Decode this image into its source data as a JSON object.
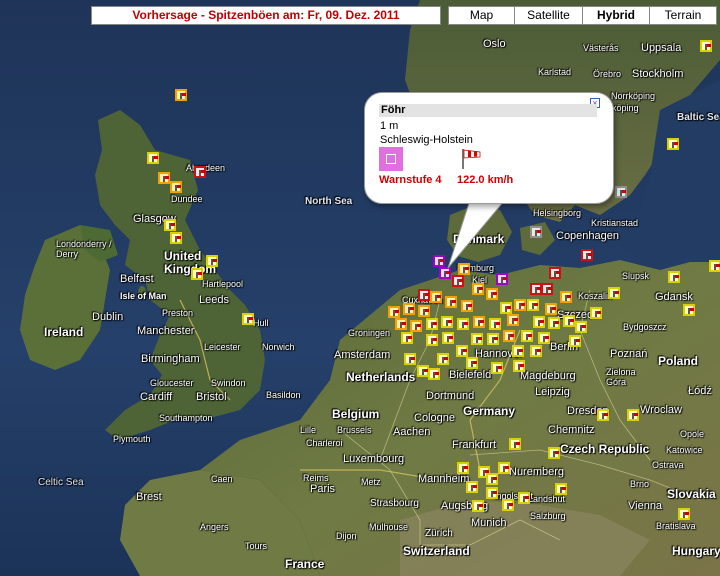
{
  "header": {
    "forecast_title": "Vorhersage - Spitzenböen am: Fr, 09. Dez. 2011"
  },
  "map_types": [
    {
      "label": "Map",
      "active": false
    },
    {
      "label": "Satellite",
      "active": false
    },
    {
      "label": "Hybrid",
      "active": true
    },
    {
      "label": "Terrain",
      "active": false
    }
  ],
  "info_window": {
    "station": "Föhr",
    "elevation": "1 m",
    "region": "Schleswig-Holstein",
    "warning_level": "Warnstufe 4",
    "gust_speed": "122.0  km/h",
    "warning_color": "#e070e0",
    "windsock_icon": "windsock-icon"
  },
  "map_labels": {
    "oslo": "Oslo",
    "vasteras": "Västerås",
    "uppsala": "Uppsala",
    "stockholm": "Stockholm",
    "karlstad": "Karlstad",
    "orebro": "Örebro",
    "norrkoping": "Norrköping",
    "linkoping": "Linköping",
    "baltic_sea": "Baltic Sea",
    "aberdeen": "Aberdeen",
    "dundee": "Dundee",
    "glasgow": "Glasgow",
    "londonderry": "Londonderry /\nDerry",
    "belfast": "Belfast",
    "united_kingdom": "United\nKingdom",
    "hartlepool": "Hartlepool",
    "isle_of_man": "Isle of Man",
    "leeds": "Leeds",
    "dublin": "Dublin",
    "preston": "Preston",
    "hull": "Hull",
    "ireland": "Ireland",
    "manchester": "Manchester",
    "leicester": "Leicester",
    "norwich": "Norwich",
    "birmingham": "Birmingham",
    "gloucester": "Gloucester",
    "swindon": "Swindon",
    "basildon": "Basildon",
    "cardiff": "Cardiff",
    "bristol": "Bristol",
    "southampton": "Southampton",
    "plymouth": "Plymouth",
    "celtic_sea": "Celtic Sea",
    "north_sea": "North Sea",
    "denmark": "Denmark",
    "helsingborg": "Helsingborg",
    "kristianstad": "Kristianstad",
    "copenhagen": "Copenhagen",
    "hamburg": "Hamburg",
    "kiel": "Kiel",
    "cuxhaven": "Cuxhaven",
    "koszalin": "Koszalin",
    "slupsk": "Slupsk",
    "gdansk": "Gdansk",
    "szczecin": "Szczecin",
    "bydgoszcz": "Bydgoszcz",
    "groningen": "Groningen",
    "amsterdam": "Amsterdam",
    "netherlands": "Netherlands",
    "hannover": "Hannover",
    "bielefeld": "Bielefeld",
    "berlin": "Berlin",
    "magdeburg": "Magdeburg",
    "poznan": "Poznań",
    "poland": "Poland",
    "zielona_gora": "Zielona\nGóra",
    "lodz": "Łódź",
    "dortmund": "Dortmund",
    "leipzig": "Leipzig",
    "wroclaw": "Wroclaw",
    "belgium": "Belgium",
    "cologne": "Cologne",
    "germany": "Germany",
    "dresden": "Dresden",
    "opole": "Opole",
    "lille": "Lille",
    "brussels": "Brussels",
    "aachen": "Aachen",
    "chemnitz": "Chemnitz",
    "czech_republic": "Czech Republic",
    "katowice": "Katowice",
    "charleroi": "Charleroi",
    "frankfurt": "Frankfurt",
    "luxembourg": "Luxembourg",
    "ostrava": "Ostrava",
    "caen": "Caen",
    "reims": "Reims",
    "metz": "Metz",
    "mannheim": "Mannheim",
    "nuremberg": "Nuremberg",
    "brno": "Brno",
    "brest": "Brest",
    "paris": "Paris",
    "strasbourg": "Strasbourg",
    "slovakia": "Slovakia",
    "angers": "Angers",
    "augsburg": "Augsburg",
    "salzburg": "Salzburg",
    "vienna": "Vienna",
    "munich": "Munich",
    "bratislava": "Bratislava",
    "tours": "Tours",
    "mulhouse": "Mulhouse",
    "dijon": "Dijon",
    "zurich": "Zürich",
    "france": "France",
    "switzerland": "Switzerland",
    "hungary": "Hungary",
    "landshut": "Landshut",
    "ingolstadt": "Ingolstadt"
  }
}
